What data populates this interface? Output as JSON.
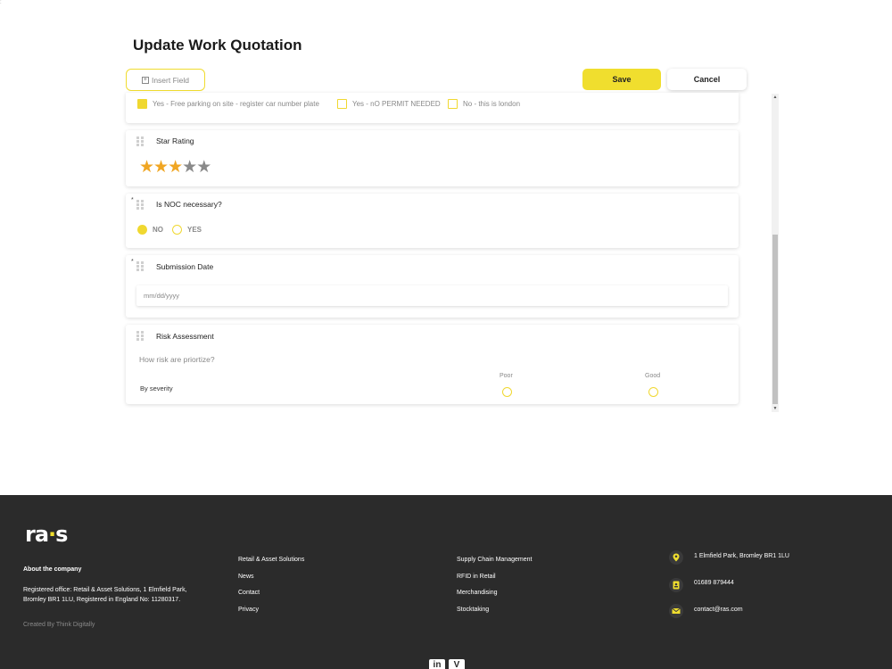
{
  "corner_mark": ":",
  "page": {
    "title": "Update Work Quotation"
  },
  "toolbar": {
    "insert_field_label": "Insert Field",
    "save_label": "Save",
    "cancel_label": "Cancel"
  },
  "parking_options": [
    {
      "label": "Yes - Free parking on site - register car number plate",
      "checked": true
    },
    {
      "label": "Yes - nO PERMIT NEEDED",
      "checked": false
    },
    {
      "label": "No - this is london",
      "checked": false
    }
  ],
  "star_rating": {
    "label": "Star Rating",
    "value": 3,
    "max": 5,
    "glyph": "★"
  },
  "noc": {
    "required_mark": "*",
    "label": "Is NOC necessary?",
    "options": [
      {
        "label": "NO",
        "selected": true
      },
      {
        "label": "YES",
        "selected": false
      }
    ]
  },
  "submission_date": {
    "required_mark": "*",
    "label": "Submission Date",
    "placeholder": "mm/dd/yyyy"
  },
  "risk": {
    "label": "Risk Assessment",
    "question": "How risk are priortize?",
    "columns": [
      "Poor",
      "Good"
    ],
    "rows": [
      "By severity"
    ]
  },
  "scrollbar": {
    "up": "▲",
    "down": "▼"
  },
  "footer": {
    "logo_text_a": "ra",
    "logo_text_b": "s",
    "about_heading": "About the company",
    "about_text": "Registered office: Retail & Asset Solutions, 1 Elmfield Park, Bromley BR1 1LU, Registered in England No: 11280317.",
    "created_by": "Created By Think Digitally",
    "links_col1": [
      "Retail & Asset Solutions",
      "News",
      "Contact",
      "Privacy"
    ],
    "links_col2": [
      "Supply Chain Management",
      "RFID in Retail",
      "Merchandising",
      "Stocktaking"
    ],
    "contact": {
      "address": "1 Elmfield Park, Bromley BR1 1LU",
      "phone": "01689 879444",
      "email": "contact@ras.com"
    },
    "social": [
      "in",
      "V"
    ],
    "accent": "#f0de2e"
  }
}
